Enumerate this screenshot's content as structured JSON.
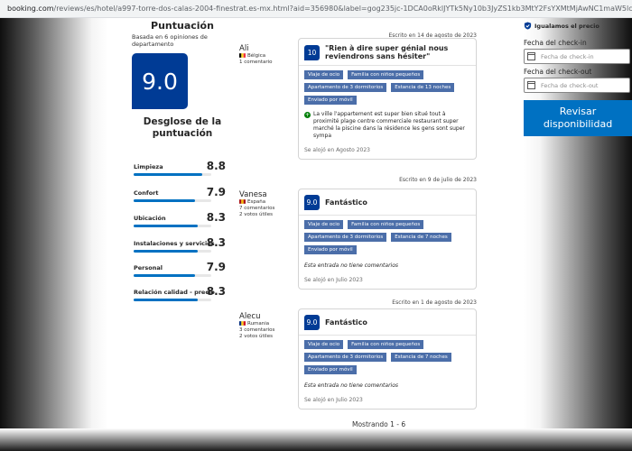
{
  "browser": {
    "host": "booking.com",
    "path": "/reviews/es/hotel/a997-torre-dos-calas-2004-finestrat.es-mx.html?aid=356980&label=gog235jc-1DCA0oRklJYTk5Ny10b3JyZS1kb3MtY2FsYXMtMjAwNC1maW5lc3RyYXRiUg/dEalAQGYAVK4ARfIAQzYAQ"
  },
  "score_panel": {
    "title": "Puntuación",
    "basis": "Basada en 6 opiniones de departamento",
    "overall": "9.0",
    "breakdown_title": "Desglose de la puntuación",
    "categories": [
      {
        "label": "Limpieza",
        "value": "8.8",
        "level": 0.88
      },
      {
        "label": "Confort",
        "value": "7.9",
        "level": 0.79
      },
      {
        "label": "Ubicación",
        "value": "8.3",
        "level": 0.83
      },
      {
        "label": "Instalaciones y servicios",
        "value": "8.3",
        "level": 0.83
      },
      {
        "label": "Personal",
        "value": "7.9",
        "level": 0.79
      },
      {
        "label": "Relación calidad - precio",
        "value": "8.3",
        "level": 0.83
      }
    ]
  },
  "reviews": [
    {
      "name": "Ali",
      "country": "Bélgica",
      "flag_colors": [
        "#000000",
        "#fdda24",
        "#ef3340"
      ],
      "stats": [
        "1 comentario"
      ],
      "date": "Escrito en 14 de agosto de 2023",
      "score": "10",
      "title": "\"Rien à dire super génial nous reviendrons sans hésiter\"",
      "tags": [
        "Viaje de ocio",
        "Familia con niños pequeños",
        "Apartamento de 3 dormitorios",
        "Estancia de 13 noches",
        "Enviado por móvil"
      ],
      "positive": "La ville l'appartement est super bien situé tout à proximité plage centre commerciale restaurant super marché la piscine dans la résidence les gens sont super sympa",
      "stay": "Se alojó en Agosto 2023"
    },
    {
      "name": "Vanesa",
      "country": "España",
      "flag_colors": [
        "#aa151b",
        "#f1bf00",
        "#aa151b"
      ],
      "stats": [
        "7 comentarios",
        "2 votos útiles"
      ],
      "date": "Escrito en 9 de julio de 2023",
      "score": "9.0",
      "title": "Fantástico",
      "tags": [
        "Viaje de ocio",
        "Familia con niños pequeños",
        "Apartamento de 3 dormitorios",
        "Estancia de 7 noches",
        "Enviado por móvil"
      ],
      "no_comment": "Esta entrada no tiene comentarios",
      "stay": "Se alojó en Julio 2023"
    },
    {
      "name": "Alecu",
      "country": "Rumania",
      "flag_colors": [
        "#002b7f",
        "#fcd116",
        "#ce1126"
      ],
      "stats": [
        "3 comentarios",
        "2 votos útiles"
      ],
      "date": "Escrito en 1 de agosto de 2023",
      "score": "9.0",
      "title": "Fantástico",
      "tags": [
        "Viaje de ocio",
        "Familia con niños pequeños",
        "Apartamento de 3 dormitorios",
        "Estancia de 7 noches",
        "Enviado por móvil"
      ],
      "no_comment": "Esta entrada no tiene comentarios",
      "stay": "Se alojó en Julio 2023"
    }
  ],
  "booking": {
    "match_text": "Igualamos el precio",
    "checkin_label": "Fecha del check-in",
    "checkin_placeholder": "Fecha de check-in",
    "checkout_label": "Fecha del check-out",
    "checkout_placeholder": "Fecha de check-out",
    "button_label": "Revisar disponibilidad"
  },
  "pagination": "Mostrando 1 - 6",
  "colors": {
    "brand": "#003b95",
    "accent": "#0071c2",
    "tag": "#4b6ea9",
    "positive": "#008009"
  }
}
